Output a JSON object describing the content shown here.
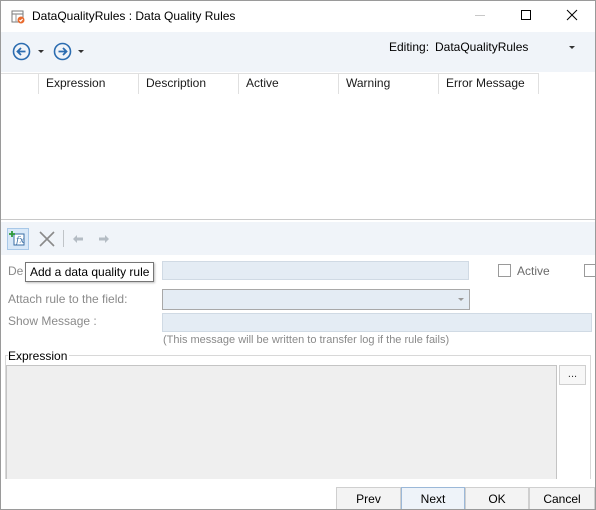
{
  "window": {
    "title": "DataQualityRules : Data Quality Rules",
    "icons": {
      "app": "table-rules-icon",
      "minimize": "minimize-icon",
      "maximize": "maximize-icon",
      "close": "close-icon"
    }
  },
  "nav": {
    "back_icon": "arrow-left-circle-icon",
    "forward_icon": "arrow-right-circle-icon",
    "editing_label": "Editing:",
    "editing_value": "DataQualityRules"
  },
  "grid": {
    "columns": [
      "",
      "Expression",
      "Description",
      "Active",
      "Warning",
      "Error Message"
    ],
    "rows": []
  },
  "rules_toolbar": {
    "add_icon": "add-rule-icon",
    "delete_icon": "delete-x-icon",
    "move_up_icon": "arrow-left-small-icon",
    "move_down_icon": "arrow-right-small-icon"
  },
  "tooltip": "Add a data quality rule",
  "form": {
    "description_label": "De",
    "description_value": "",
    "active_label": "Active",
    "attach_label": "Attach rule to the field:",
    "attach_value": "",
    "show_message_label": "Show Message :",
    "show_message_value": "",
    "hint": "(This message will be written to transfer log if the rule fails)"
  },
  "expression": {
    "group_label": "Expression",
    "value": "",
    "browse_label": "..."
  },
  "buttons": {
    "prev": "Prev",
    "next": "Next",
    "ok": "OK",
    "cancel": "Cancel"
  },
  "colors": {
    "toolbar_bg": "#f0f4f9",
    "accent_blue": "#2b6cb0",
    "field_bg": "#e4ecf4"
  }
}
